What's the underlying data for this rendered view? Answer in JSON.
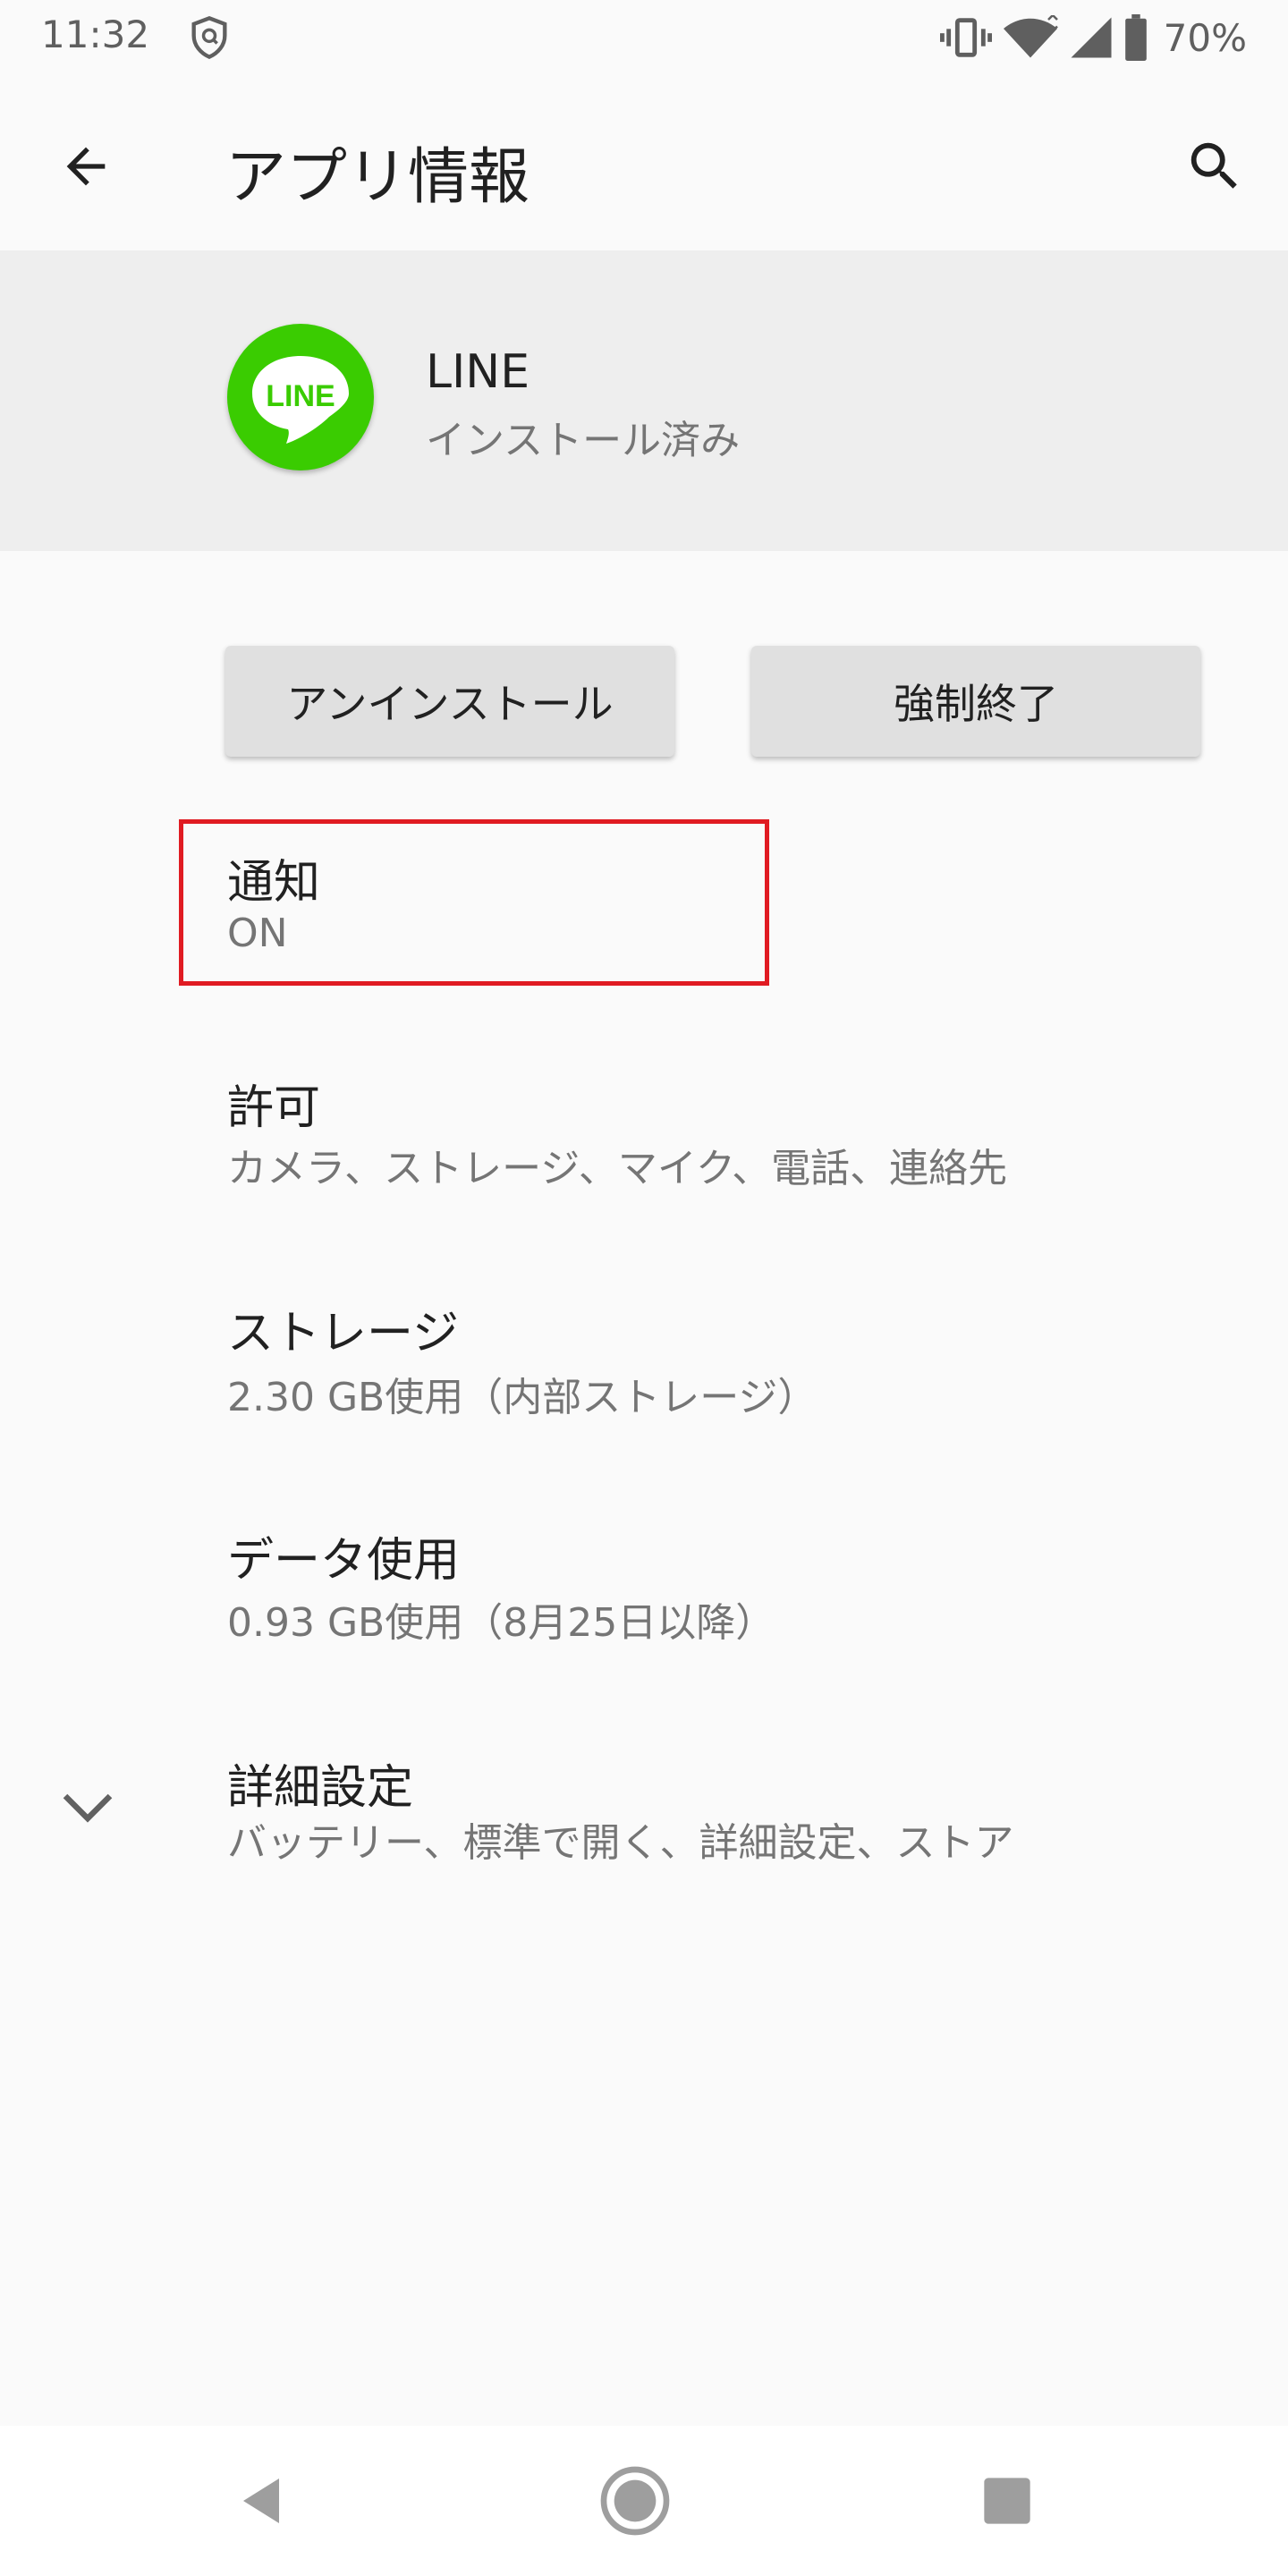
{
  "status_bar": {
    "time": "11:32",
    "battery": "70%",
    "icons": [
      "shield-icon",
      "vibrate-icon",
      "wifi-icon",
      "signal-icon",
      "battery-icon"
    ]
  },
  "app_bar": {
    "title": "アプリ情報",
    "icons": [
      "back-arrow-icon",
      "search-icon"
    ]
  },
  "app_header": {
    "name": "LINE",
    "status": "インストール済み",
    "icon_label": "LINE",
    "icon_color": "#3acc01"
  },
  "actions": {
    "uninstall_label": "アンインストール",
    "force_stop_label": "強制終了"
  },
  "items": [
    {
      "title": "通知",
      "summary": "ON"
    },
    {
      "title": "許可",
      "summary": "カメラ、ストレージ、マイク、電話、連絡先"
    },
    {
      "title": "ストレージ",
      "summary": "2.30 GB使用（内部ストレージ）"
    },
    {
      "title": "データ使用",
      "summary": "0.93 GB使用（8月25日以降）"
    },
    {
      "title": "詳細設定",
      "summary": "バッテリー、標準で開く、詳細設定、ストア"
    }
  ],
  "highlight_color": "#e01b22",
  "nav_bar": {
    "icons": [
      "nav-back-icon",
      "nav-home-icon",
      "nav-recents-icon"
    ]
  }
}
